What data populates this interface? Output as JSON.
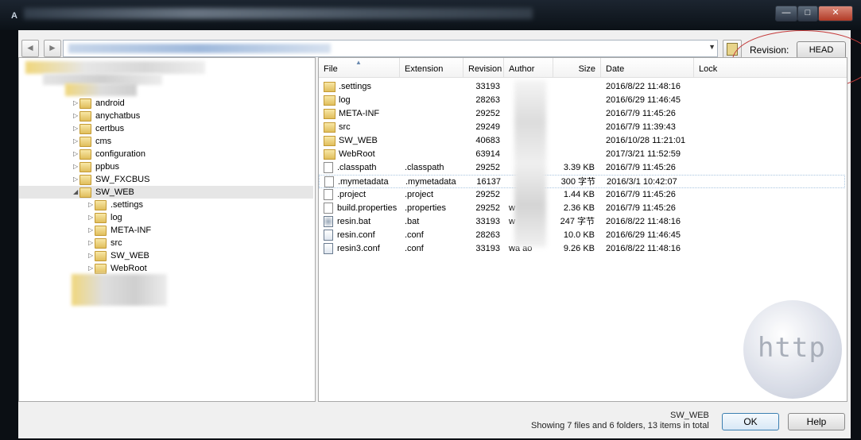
{
  "window": {
    "app_letter": "A",
    "minimize_glyph": "—",
    "maximize_glyph": "□",
    "close_glyph": "✕"
  },
  "toolbar": {
    "back_icon": "arrow-left-icon",
    "forward_icon": "arrow-right-icon",
    "combo_arrow": "▼",
    "revision_label": "Revision:",
    "revision_button": "HEAD"
  },
  "tree": {
    "items": [
      {
        "label": "android"
      },
      {
        "label": "anychatbus"
      },
      {
        "label": "certbus"
      },
      {
        "label": "cms"
      },
      {
        "label": "configuration"
      },
      {
        "label": "ppbus"
      },
      {
        "label": "SW_FXCBUS"
      },
      {
        "label": "SW_WEB"
      },
      {
        "label": ".settings"
      },
      {
        "label": "log"
      },
      {
        "label": "META-INF"
      },
      {
        "label": "src"
      },
      {
        "label": "SW_WEB"
      },
      {
        "label": "WebRoot"
      }
    ],
    "selected_index": 7
  },
  "list": {
    "columns": [
      "File",
      "Extension",
      "Revision",
      "Author",
      "Size",
      "Date",
      "Lock"
    ],
    "rows": [
      {
        "file": ".settings",
        "ext": "",
        "rev": "33193",
        "author": "",
        "size": "",
        "date": "2016/8/22 11:48:16",
        "kind": "folder"
      },
      {
        "file": "log",
        "ext": "",
        "rev": "28263",
        "author": "",
        "size": "",
        "date": "2016/6/29 11:46:45",
        "kind": "folder"
      },
      {
        "file": "META-INF",
        "ext": "",
        "rev": "29252",
        "author": "",
        "size": "",
        "date": "2016/7/9 11:45:26",
        "kind": "folder"
      },
      {
        "file": "src",
        "ext": "",
        "rev": "29249",
        "author": "",
        "size": "",
        "date": "2016/7/9 11:39:43",
        "kind": "folder"
      },
      {
        "file": "SW_WEB",
        "ext": "",
        "rev": "40683",
        "author": "",
        "size": "",
        "date": "2016/10/28 11:21:01",
        "kind": "folder"
      },
      {
        "file": "WebRoot",
        "ext": "",
        "rev": "63914",
        "author": "",
        "size": "",
        "date": "2017/3/21 11:52:59",
        "kind": "folder"
      },
      {
        "file": ".classpath",
        "ext": ".classpath",
        "rev": "29252",
        "author": "",
        "size": "3.39 KB",
        "date": "2016/7/9 11:45:26",
        "kind": "file"
      },
      {
        "file": ".mymetadata",
        "ext": ".mymetadata",
        "rev": "16137",
        "author": "",
        "size": "300 字节",
        "date": "2016/3/1 10:42:07",
        "kind": "file"
      },
      {
        "file": ".project",
        "ext": ".project",
        "rev": "29252",
        "author": "",
        "size": "1.44 KB",
        "date": "2016/7/9 11:45:26",
        "kind": "file"
      },
      {
        "file": "build.properties",
        "ext": ".properties",
        "rev": "29252",
        "author": "w",
        "size": "2.36 KB",
        "date": "2016/7/9 11:45:26",
        "kind": "file"
      },
      {
        "file": "resin.bat",
        "ext": ".bat",
        "rev": "33193",
        "author": "w",
        "size": "247 字节",
        "date": "2016/8/22 11:48:16",
        "kind": "bat"
      },
      {
        "file": "resin.conf",
        "ext": ".conf",
        "rev": "28263",
        "author": "",
        "size": "10.0 KB",
        "date": "2016/6/29 11:46:45",
        "kind": "conf"
      },
      {
        "file": "resin3.conf",
        "ext": ".conf",
        "rev": "33193",
        "author": "wa    ao",
        "size": "9.26 KB",
        "date": "2016/8/22 11:48:16",
        "kind": "conf"
      }
    ],
    "highlight_index": 7
  },
  "watermark": "http",
  "status": {
    "path": "SW_WEB",
    "summary": "Showing 7 files and 6 folders, 13 items in total"
  },
  "buttons": {
    "ok": "OK",
    "help": "Help"
  }
}
